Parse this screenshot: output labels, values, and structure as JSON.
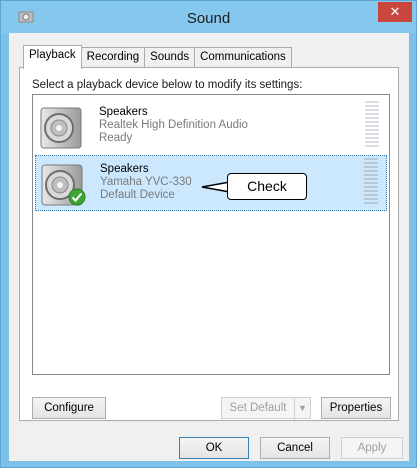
{
  "window": {
    "title": "Sound",
    "close_glyph": "✕"
  },
  "tabs": [
    {
      "label": "Playback",
      "active": true
    },
    {
      "label": "Recording",
      "active": false
    },
    {
      "label": "Sounds",
      "active": false
    },
    {
      "label": "Communications",
      "active": false
    }
  ],
  "instruction": "Select a playback device below to modify its settings:",
  "devices": [
    {
      "name": "Speakers",
      "description": "Realtek High Definition Audio",
      "status": "Ready",
      "selected": false,
      "default": false
    },
    {
      "name": "Speakers",
      "description": "Yamaha YVC-330",
      "status": "Default Device",
      "selected": true,
      "default": true
    }
  ],
  "callout": {
    "text": "Check"
  },
  "panel_buttons": {
    "configure": "Configure",
    "set_default": "Set Default",
    "properties": "Properties"
  },
  "dialog_buttons": {
    "ok": "OK",
    "cancel": "Cancel",
    "apply": "Apply"
  },
  "colors": {
    "title_bar": "#86c7ee",
    "close_button": "#c9463d",
    "selection": "#cce8ff",
    "default_check": "#3fa535"
  },
  "icons": {
    "app": "speaker-app-icon",
    "device": "speaker-icon",
    "default_badge": "green-check-icon"
  }
}
